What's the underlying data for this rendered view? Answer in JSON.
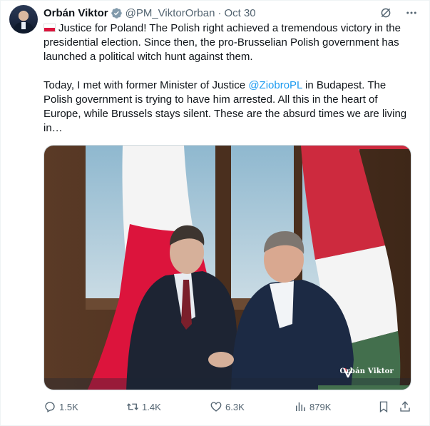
{
  "author": {
    "name": "Orbán Viktor",
    "handle": "@PM_ViktorOrban",
    "separator": "·",
    "date": "Oct 30"
  },
  "icons": {
    "verified": "verified-badge-icon",
    "grok": "grok-icon",
    "more": "more-icon",
    "flag": "poland-flag-emoji"
  },
  "tweet": {
    "paragraph1": "Justice for Poland! The Polish right achieved a tremendous victory in the presidential election. Since then, the pro-Brusselian Polish government has launched a political witch hunt against them.",
    "paragraph2_before": "Today, I met with former Minister of Justice ",
    "mention": "@ZiobroPL",
    "paragraph2_after": " in Budapest. The Polish government is trying to have him arrested. All this in the heart of Europe, while Brussels stays silent. These are the absurd times we are living in…"
  },
  "media": {
    "watermark": "Orbán Viktor"
  },
  "actions": {
    "replies": "1.5K",
    "retweets": "1.4K",
    "likes": "6.3K",
    "views": "879K"
  },
  "colors": {
    "accent": "#1d9bf0",
    "muted": "#536471",
    "verified": "#829aab",
    "polish_red": "#dc143c",
    "hungarian_red": "#cd2a3e",
    "hungarian_green": "#436f4d"
  }
}
